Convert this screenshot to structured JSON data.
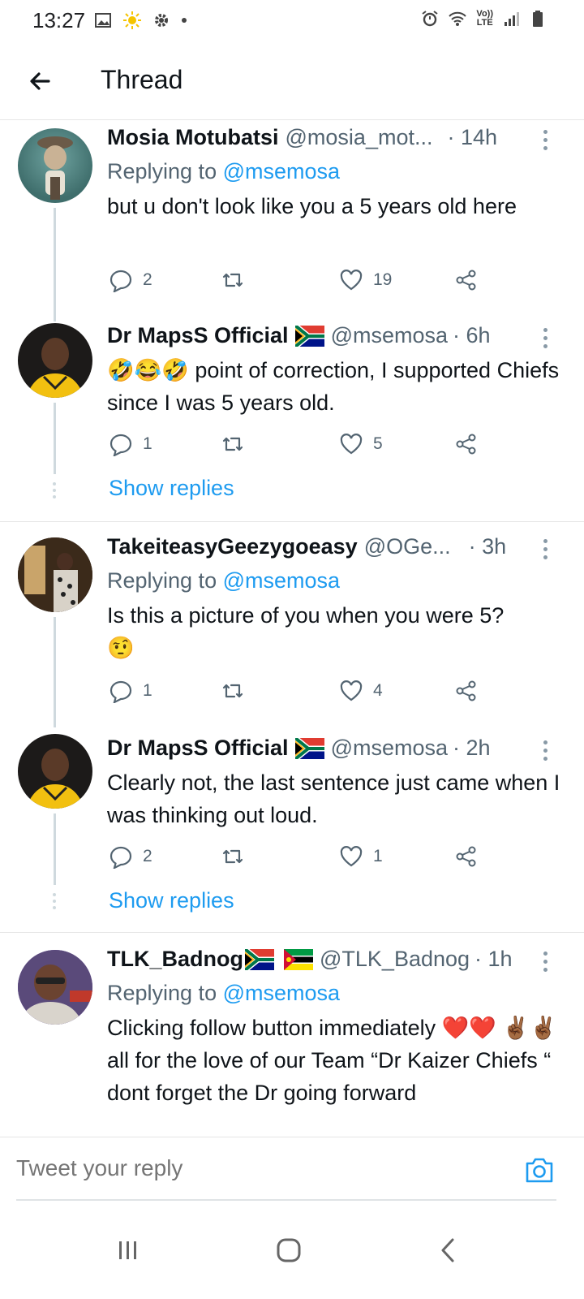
{
  "status_bar": {
    "time": "13:27",
    "lte_top": "Vo))",
    "lte_bottom": "LTE"
  },
  "header": {
    "title": "Thread"
  },
  "tweets": [
    {
      "name": "Mosia Motubatsi",
      "handle": "@mosia_mot...",
      "time": "· 14h",
      "replying_prefix": "Replying to ",
      "replying_mention": "@msemosa",
      "text": "but u don't look like you a 5 years old here",
      "replies": "2",
      "retweets": "",
      "likes": "19"
    },
    {
      "name": "Dr MapsS Official",
      "handle": "@msemosa",
      "time": "· 6h",
      "emoji": "🤣😂🤣",
      "text": " point of correction, I supported Chiefs since I was 5 years old.",
      "replies": "1",
      "retweets": "",
      "likes": "5",
      "show_replies": "Show replies"
    },
    {
      "name": "TakeiteasyGeezygoeasy",
      "handle": "@OGe...",
      "time": "· 3h",
      "replying_prefix": "Replying to ",
      "replying_mention": "@msemosa",
      "text": "Is this a picture of you when you were 5?",
      "emoji": "🤨",
      "replies": "1",
      "retweets": "",
      "likes": "4"
    },
    {
      "name": "Dr MapsS Official",
      "handle": "@msemosa",
      "time": "· 2h",
      "text": "Clearly not, the last sentence just came when I was thinking out loud.",
      "replies": "2",
      "retweets": "",
      "likes": "1",
      "show_replies": "Show replies"
    },
    {
      "name": "TLK_Badnog",
      "handle": "@TLK_Badnog",
      "time": "· 1h",
      "replying_prefix": "Replying to ",
      "replying_mention": "@msemosa",
      "text": "Clicking follow button immediately ❤️❤️ ✌🏾✌🏾 all for the love of our Team “Dr Kaizer Chiefs “ dont forget the Dr going forward"
    }
  ],
  "composer": {
    "placeholder": "Tweet your reply"
  },
  "colors": {
    "link": "#1d9bf0",
    "secondary_text": "#536471",
    "primary_text": "#0f1419",
    "divider": "#e6e6e6"
  }
}
